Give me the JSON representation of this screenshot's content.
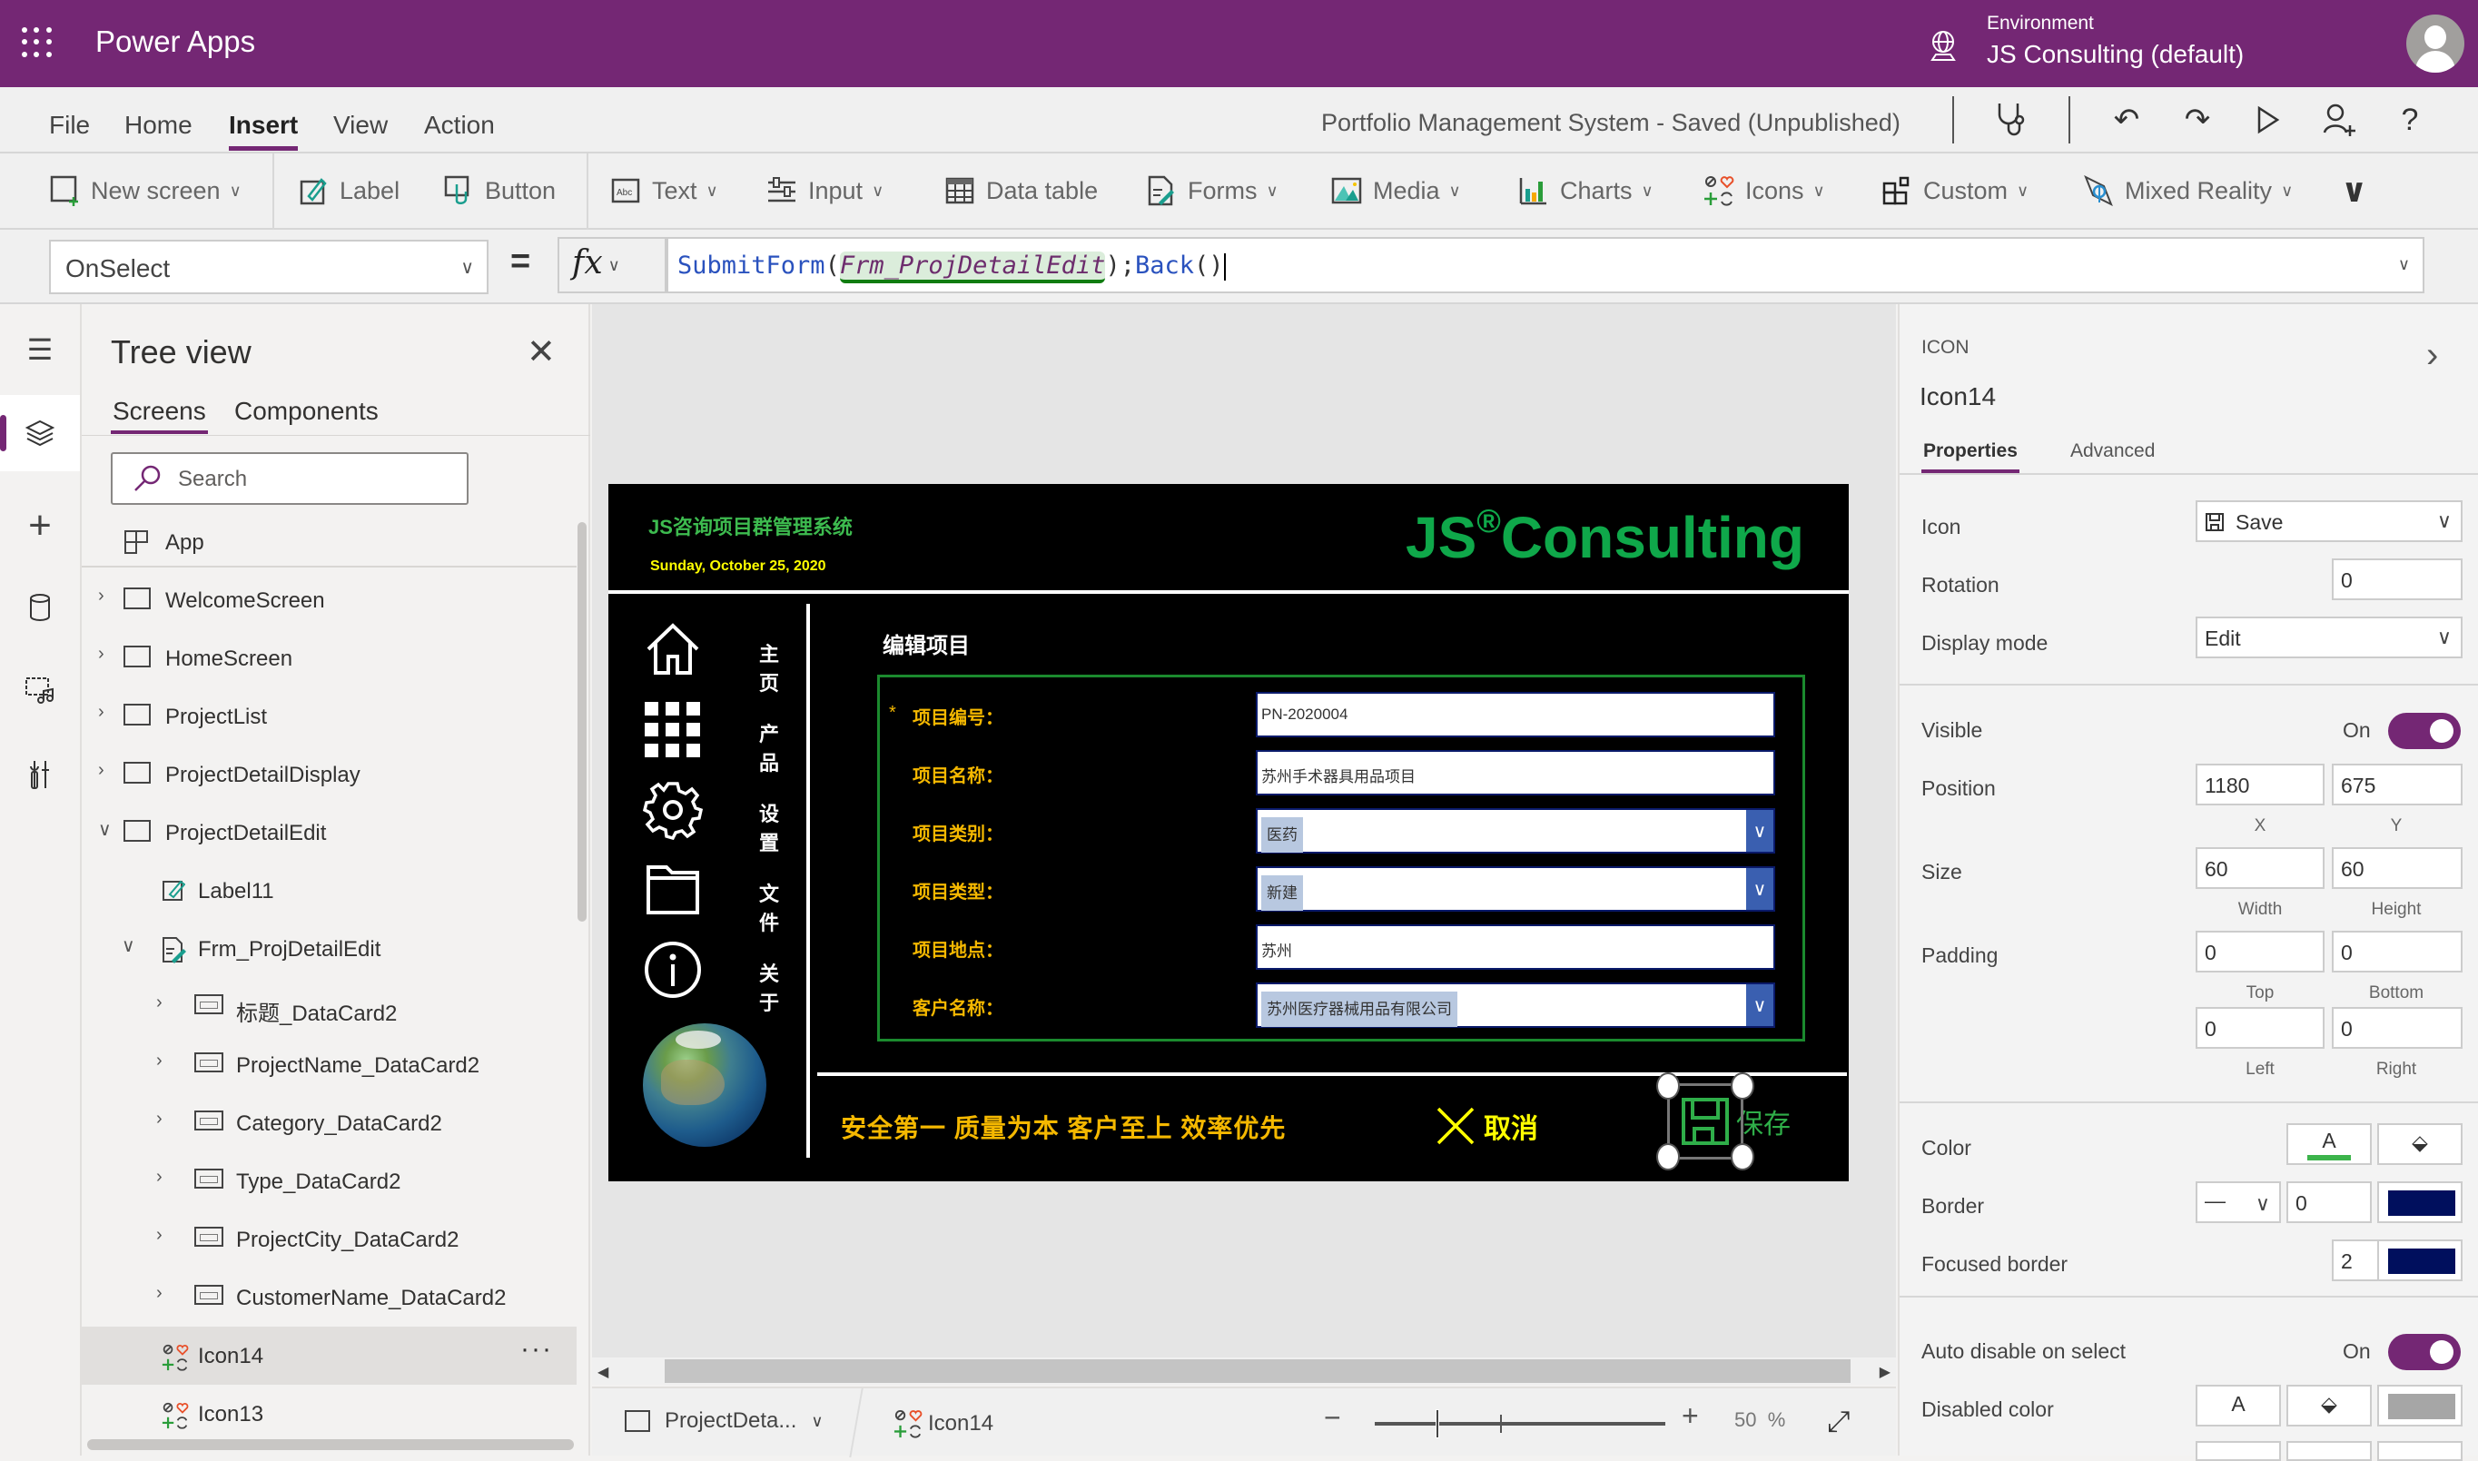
{
  "topbar": {
    "app_name": "Power Apps",
    "environment_label": "Environment",
    "environment_value": "JS Consulting (default)"
  },
  "menu": {
    "items": [
      "File",
      "Home",
      "Insert",
      "View",
      "Action"
    ],
    "active": "Insert",
    "app_status": "Portfolio Management System - Saved (Unpublished)"
  },
  "ribbon": {
    "items": [
      {
        "label": "New screen",
        "icon": "new-screen-icon",
        "dropdown": true
      },
      {
        "label": "Label",
        "icon": "label-icon",
        "dropdown": false
      },
      {
        "label": "Button",
        "icon": "button-icon",
        "dropdown": false
      },
      {
        "label": "Text",
        "icon": "text-icon",
        "dropdown": true
      },
      {
        "label": "Input",
        "icon": "input-icon",
        "dropdown": true
      },
      {
        "label": "Data table",
        "icon": "data-table-icon",
        "dropdown": false
      },
      {
        "label": "Forms",
        "icon": "forms-icon",
        "dropdown": true
      },
      {
        "label": "Media",
        "icon": "media-icon",
        "dropdown": true
      },
      {
        "label": "Charts",
        "icon": "charts-icon",
        "dropdown": true
      },
      {
        "label": "Icons",
        "icon": "icons-icon",
        "dropdown": true
      },
      {
        "label": "Custom",
        "icon": "custom-icon",
        "dropdown": true
      },
      {
        "label": "Mixed Reality",
        "icon": "mixed-reality-icon",
        "dropdown": true
      }
    ]
  },
  "formula": {
    "property": "OnSelect",
    "equals": "=",
    "fx": "fx",
    "func1": "SubmitForm",
    "open1": "(",
    "arg": "Frm_ProjDetailEdit",
    "close1": ")",
    "sep": ";",
    "func2": "Back",
    "parens": "()"
  },
  "tree": {
    "title": "Tree view",
    "tabs": [
      "Screens",
      "Components"
    ],
    "active_tab": "Screens",
    "search_placeholder": "Search",
    "rows": [
      {
        "label": "App",
        "type": "app",
        "level": 0,
        "expand": "none"
      },
      {
        "label": "WelcomeScreen",
        "type": "screen",
        "level": 0,
        "expand": "collapsed"
      },
      {
        "label": "HomeScreen",
        "type": "screen",
        "level": 0,
        "expand": "collapsed"
      },
      {
        "label": "ProjectList",
        "type": "screen",
        "level": 0,
        "expand": "collapsed"
      },
      {
        "label": "ProjectDetailDisplay",
        "type": "screen",
        "level": 0,
        "expand": "collapsed"
      },
      {
        "label": "ProjectDetailEdit",
        "type": "screen",
        "level": 0,
        "expand": "expanded"
      },
      {
        "label": "Label11",
        "type": "label",
        "level": 1,
        "expand": "none"
      },
      {
        "label": "Frm_ProjDetailEdit",
        "type": "form",
        "level": 1,
        "expand": "expanded"
      },
      {
        "label": "标题_DataCard2",
        "type": "card",
        "level": 2,
        "expand": "collapsed"
      },
      {
        "label": "ProjectName_DataCard2",
        "type": "card",
        "level": 2,
        "expand": "collapsed"
      },
      {
        "label": "Category_DataCard2",
        "type": "card",
        "level": 2,
        "expand": "collapsed"
      },
      {
        "label": "Type_DataCard2",
        "type": "card",
        "level": 2,
        "expand": "collapsed"
      },
      {
        "label": "ProjectCity_DataCard2",
        "type": "card",
        "level": 2,
        "expand": "collapsed"
      },
      {
        "label": "CustomerName_DataCard2",
        "type": "card",
        "level": 2,
        "expand": "collapsed"
      },
      {
        "label": "Icon14",
        "type": "icon",
        "level": 1,
        "expand": "none",
        "selected": true
      },
      {
        "label": "Icon13",
        "type": "icon",
        "level": 1,
        "expand": "none"
      }
    ],
    "more": "···"
  },
  "app_screen": {
    "title": "JS咨询项目群管理系统",
    "date": "Sunday, October 25, 2020",
    "brand_prefix": "JS",
    "brand_mark": "®",
    "brand_suffix": "Consulting",
    "nav": [
      {
        "label": "主页",
        "icon": "home-icon"
      },
      {
        "label": "产品",
        "icon": "grid-icon"
      },
      {
        "label": "设置",
        "icon": "settings-icon"
      },
      {
        "label": "文件",
        "icon": "folder-icon"
      },
      {
        "label": "关于",
        "icon": "info-icon"
      }
    ],
    "form_title": "编辑项目",
    "form_fields": [
      {
        "label": "项目编号：",
        "required": true,
        "value": "PN-2020004",
        "type": "text"
      },
      {
        "label": "项目名称：",
        "required": false,
        "value": "苏州手术器具用品项目",
        "type": "text"
      },
      {
        "label": "项目类别：",
        "required": false,
        "value": "医药",
        "type": "dropdown"
      },
      {
        "label": "项目类型：",
        "required": false,
        "value": "新建",
        "type": "dropdown"
      },
      {
        "label": "项目地点：",
        "required": false,
        "value": "苏州",
        "type": "text"
      },
      {
        "label": "客户名称：",
        "required": false,
        "value": "苏州医疗器械用品有限公司",
        "type": "dropdown"
      }
    ],
    "required_mark": "*",
    "motto": "安全第一  质量为本  客户至上  效率优先",
    "cancel_label": "取消",
    "save_label": "保存",
    "colors": {
      "title_green": "#3dbb4f",
      "brand_green": "#0fa84a",
      "date_yellow": "#ffff00",
      "label_gold": "#f5b800",
      "form_border": "#1b8a2e",
      "dropdown_blue": "#3a5fb0"
    }
  },
  "statusbar": {
    "screen": "ProjectDeta...",
    "control": "Icon14",
    "zoom_minus": "−",
    "zoom_plus": "+",
    "zoom_value": "50",
    "zoom_unit": "%",
    "zoom_percent": 50
  },
  "properties": {
    "kind": "ICON",
    "name": "Icon14",
    "tabs": [
      "Properties",
      "Advanced"
    ],
    "active_tab": "Properties",
    "icon_label": "Icon",
    "icon_value": "Save",
    "rotation_label": "Rotation",
    "rotation_value": "0",
    "display_mode_label": "Display mode",
    "display_mode_value": "Edit",
    "visible_label": "Visible",
    "visible_value": "On",
    "position_label": "Position",
    "position_x": "1180",
    "position_y": "675",
    "x_label": "X",
    "y_label": "Y",
    "size_label": "Size",
    "width": "60",
    "height": "60",
    "width_label": "Width",
    "height_label": "Height",
    "padding_label": "Padding",
    "padding_top": "0",
    "padding_bottom": "0",
    "padding_left": "0",
    "padding_right": "0",
    "top_label": "Top",
    "bottom_label": "Bottom",
    "left_label": "Left",
    "right_label": "Right",
    "color_label": "Color",
    "color_value": "#3cb44b",
    "border_label": "Border",
    "border_width": "0",
    "border_color": "#000f5d",
    "focused_border_label": "Focused border",
    "focused_border_width": "2",
    "focused_border_color": "#000f5d",
    "auto_disable_label": "Auto disable on select",
    "auto_disable_value": "On",
    "disabled_color_label": "Disabled color",
    "disabled_fill": "#a6a6a6",
    "font_glyph": "A"
  }
}
